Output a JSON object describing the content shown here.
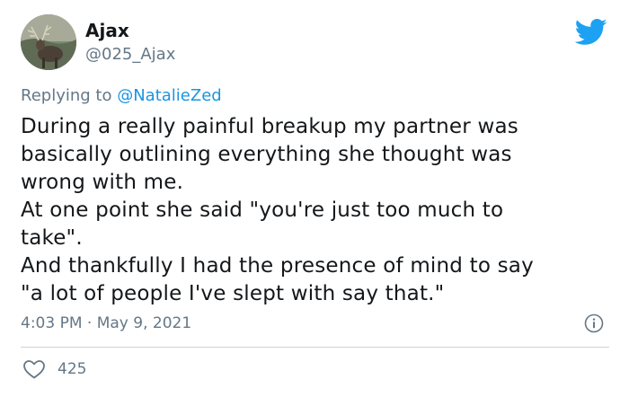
{
  "author": {
    "display_name": "Ajax",
    "handle": "@025_Ajax",
    "avatar_icon": "elk-avatar"
  },
  "reply": {
    "prefix": "Replying to",
    "mention": "@NatalieZed"
  },
  "tweet": {
    "lines": [
      "During a really painful breakup my partner was",
      "basically outlining everything she thought was",
      "wrong with me.",
      "At one point she said \"you're just too much to",
      "take\".",
      "And thankfully I had the presence of mind to say",
      "\"a lot of people I've slept with say that.\""
    ],
    "timestamp": "4:03 PM · May 9, 2021"
  },
  "actions": {
    "like_count": "425",
    "like_icon": "heart-icon",
    "info_icon": "info-icon"
  },
  "colors": {
    "text": "#14171a",
    "secondary": "#657786",
    "brand": "#1da1f2",
    "link": "#1b95e0",
    "divider": "#ccd6dd"
  }
}
